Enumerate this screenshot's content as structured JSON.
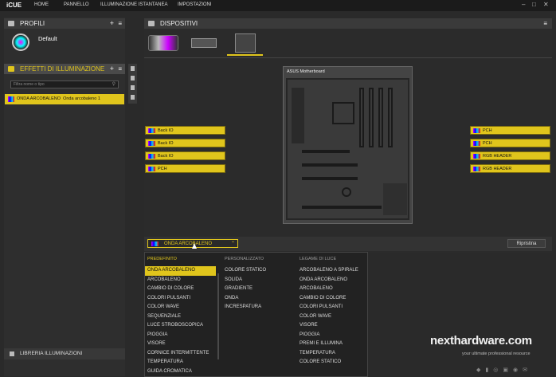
{
  "app": {
    "title": "iCUE"
  },
  "nav": [
    "HOME",
    "PANNELLO",
    "ILLUMINAZIONE ISTANTANEA",
    "IMPOSTAZIONI"
  ],
  "profiles": {
    "title": "PROFILI",
    "current": "Default"
  },
  "effects": {
    "title": "EFFETTI DI ILLUMINAZIONE",
    "search_placeholder": "Filtra nome o tipo",
    "items": [
      {
        "type": "ONDA ARCOBALENO",
        "name": "Onda arcobaleno 1"
      }
    ]
  },
  "library": {
    "label": "LIBRERIA ILLUMINAZIONI"
  },
  "devices": {
    "title": "DISPOSITIVI",
    "motherboard_label": "ASUS Motherboard"
  },
  "zones_left": [
    "Back IO",
    "Back IO",
    "Back IO",
    "PCH"
  ],
  "zones_right": [
    "PCH",
    "PCH",
    "RGB HEADER",
    "RGB HEADER"
  ],
  "effect_select": {
    "value": "ONDA ARCOBALENO"
  },
  "reset_label": "Ripristina",
  "dropdown": {
    "predefinito": {
      "header": "PREDEFINITO",
      "items": [
        "ONDA ARCOBALENO",
        "ARCOBALENO",
        "CAMBIO DI COLORE",
        "COLORI PULSANTI",
        "COLOR WAVE",
        "SEQUENZIALE",
        "LUCE STROBOSCOPICA",
        "PIOGGIA",
        "VISORE",
        "CORNICE INTERMITTENTE",
        "TEMPERATURA",
        "GUIDA CROMATICA"
      ]
    },
    "personalizzato": {
      "header": "PERSONALIZZATO",
      "items": [
        "COLORE STATICO",
        "SOLIDA",
        "GRADIENTE",
        "ONDA",
        "INCRESPATURA"
      ]
    },
    "legame": {
      "header": "LEGAME DI LUCE",
      "items": [
        "ARCOBALENO A SPIRALE",
        "ONDA ARCOBALENO",
        "ARCOBALENO",
        "CAMBIO DI COLORE",
        "COLORI PULSANTI",
        "COLOR WAVE",
        "VISORE",
        "PIOGGIA",
        "PREMI E ILLUMINA",
        "TEMPERATURA",
        "COLORE STATICO"
      ]
    }
  },
  "watermark": {
    "brand": "nexthardware.com",
    "tagline": "your ultimate professional resource"
  }
}
